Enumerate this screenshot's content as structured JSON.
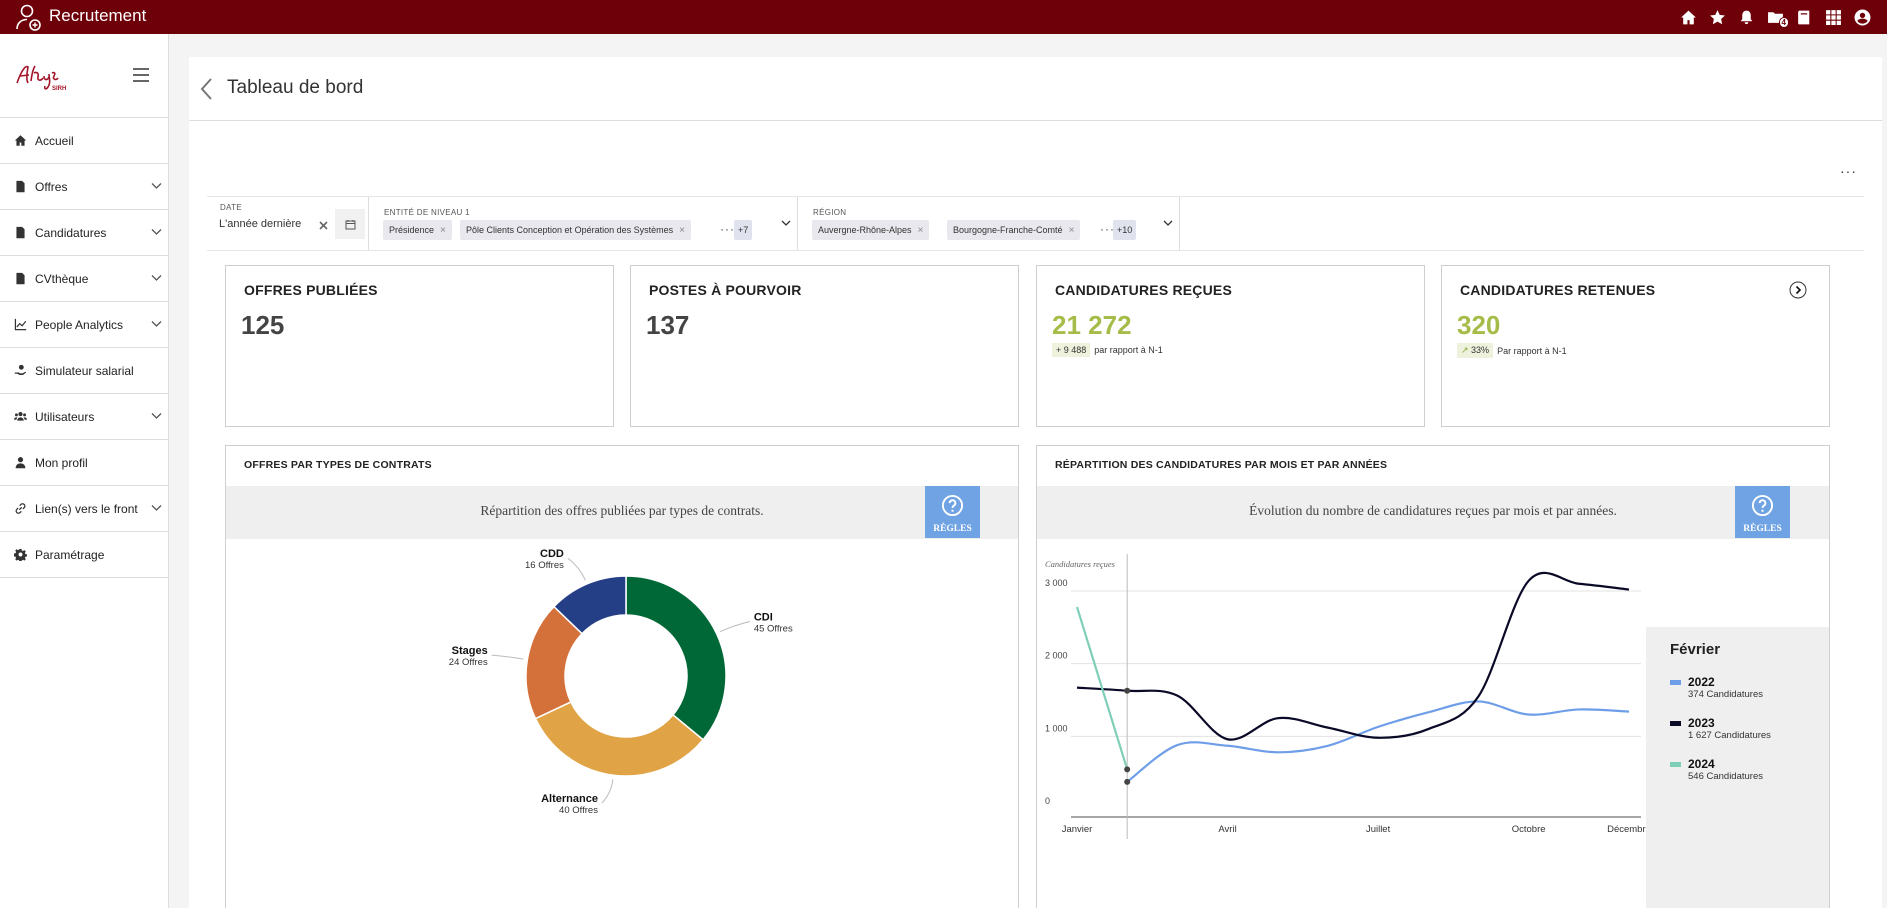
{
  "app": {
    "title": "Recrutement",
    "notifications_badge": "4"
  },
  "header": {
    "page_title": "Tableau de bord",
    "more": "···"
  },
  "sidebar": {
    "items": [
      {
        "label": "Accueil",
        "icon": "home-icon",
        "has_children": false
      },
      {
        "label": "Offres",
        "icon": "document-icon",
        "has_children": true
      },
      {
        "label": "Candidatures",
        "icon": "document-icon",
        "has_children": true
      },
      {
        "label": "CVthèque",
        "icon": "document-icon",
        "has_children": true
      },
      {
        "label": "People Analytics",
        "icon": "chart-icon",
        "has_children": true
      },
      {
        "label": "Simulateur salarial",
        "icon": "hand-coin-icon",
        "has_children": false
      },
      {
        "label": "Utilisateurs",
        "icon": "users-icon",
        "has_children": true
      },
      {
        "label": "Mon profil",
        "icon": "user-icon",
        "has_children": false
      },
      {
        "label": "Lien(s) vers le front",
        "icon": "link-icon",
        "has_children": true
      },
      {
        "label": "Paramétrage",
        "icon": "gear-icon",
        "has_children": false
      }
    ]
  },
  "filters": {
    "date": {
      "label": "DATE",
      "value": "L'année dernière"
    },
    "entity": {
      "label": "ENTITÉ DE NIVEAU 1",
      "chips": [
        "Présidence",
        "Pôle Clients Conception et Opération des Systèmes"
      ],
      "more": "+7"
    },
    "region": {
      "label": "RÉGION",
      "chips": [
        "Auvergne-Rhône-Alpes",
        "Bourgogne-Franche-Comté"
      ],
      "more": "+10"
    }
  },
  "kpis": [
    {
      "title": "OFFRES PUBLIÉES",
      "value": "125"
    },
    {
      "title": "POSTES À POURVOIR",
      "value": "137"
    },
    {
      "title": "CANDIDATURES REÇUES",
      "value": "21 272",
      "trend_value": "+ 9 488",
      "trend_text": "par rapport à N-1"
    },
    {
      "title": "CANDIDATURES RETENUES",
      "value": "320",
      "trend_value": "33%",
      "trend_text": "Par rapport à N-1"
    }
  ],
  "panels": {
    "contracts": {
      "title": "OFFRES PAR TYPES DE CONTRATS",
      "description": "Répartition des offres publiées par types de contrats.",
      "rules_label": "RÈGLES"
    },
    "monthly": {
      "title": "RÉPARTITION DES CANDIDATURES PAR MOIS ET PAR ANNÉES",
      "description": "Évolution du nombre de candidatures reçues par mois et par années.",
      "rules_label": "RÈGLES"
    }
  },
  "chart_data": [
    {
      "type": "pie",
      "categories": [
        "CDI",
        "Alternance",
        "Stages",
        "CDD"
      ],
      "values": [
        45,
        40,
        24,
        16
      ],
      "labels": [
        "45 Offres",
        "40 Offres",
        "24 Offres",
        "16 Offres"
      ],
      "colors": [
        "#006837",
        "#e0a345",
        "#d4703a",
        "#253f87"
      ]
    },
    {
      "type": "line",
      "ylabel": "Candidatures reçues",
      "yticks": [
        "0",
        "1 000",
        "2 000",
        "3 000"
      ],
      "ylim": [
        0,
        3000
      ],
      "x_tick_labels": [
        "Janvier",
        "Avril",
        "Juillet",
        "Octobre",
        "Décembre"
      ],
      "x": [
        1,
        2,
        3,
        4,
        5,
        6,
        7,
        8,
        9,
        10,
        11,
        12
      ],
      "series": [
        {
          "name": "2022",
          "color": "#6f9ee8",
          "values": [
            null,
            374,
            880,
            870,
            780,
            870,
            1130,
            1330,
            1480,
            1300,
            1370,
            1340
          ]
        },
        {
          "name": "2023",
          "color": "#0a0a28",
          "values": [
            1670,
            1627,
            1560,
            960,
            1250,
            1120,
            980,
            1100,
            1550,
            3140,
            3100,
            3020
          ]
        },
        {
          "name": "2024",
          "color": "#7fcfb8",
          "values": [
            2780,
            546,
            null,
            null,
            null,
            null,
            null,
            null,
            null,
            null,
            null,
            null
          ]
        }
      ],
      "tooltip": {
        "month": "Février",
        "entries": [
          {
            "year": "2022",
            "count": "374 Candidatures",
            "color": "#6f9ee8"
          },
          {
            "year": "2023",
            "count": "1 627 Candidatures",
            "color": "#0a0a28"
          },
          {
            "year": "2024",
            "count": "546 Candidatures",
            "color": "#7fcfb8"
          }
        ]
      }
    }
  ]
}
